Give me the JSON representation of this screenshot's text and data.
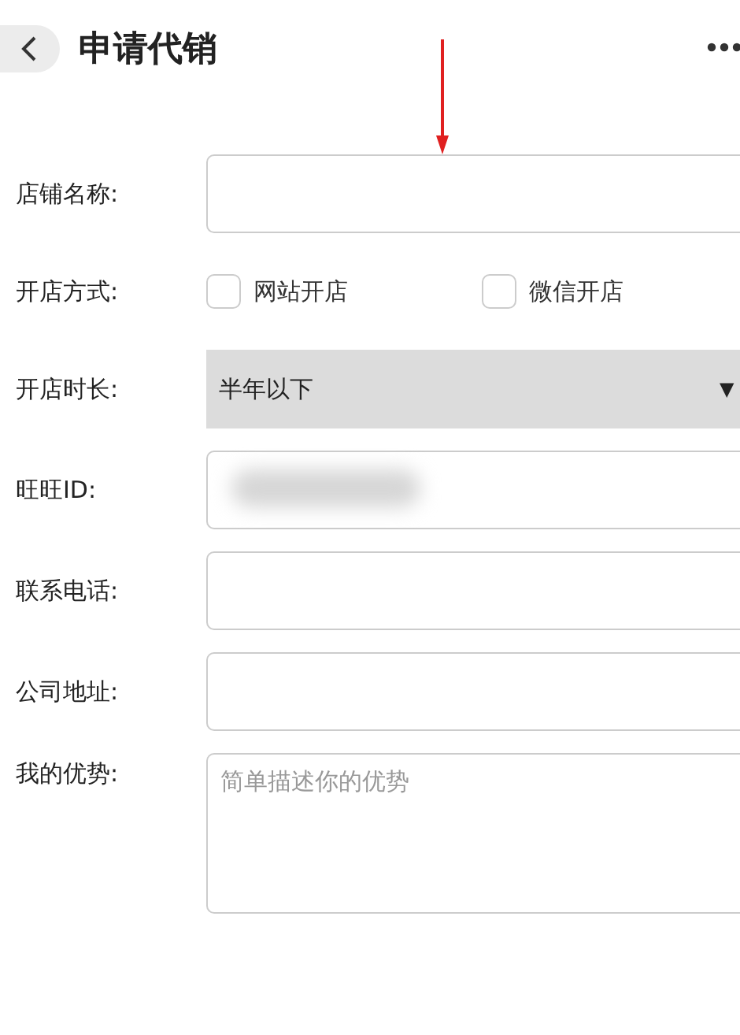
{
  "header": {
    "title": "申请代销"
  },
  "form": {
    "rows": [
      {
        "kind": "text",
        "label": "店铺名称:",
        "value_hidden": false
      },
      {
        "kind": "checks",
        "label": "开店方式:",
        "options": [
          {
            "label": "网站开店",
            "checked": false
          },
          {
            "label": "微信开店",
            "checked": false
          }
        ]
      },
      {
        "kind": "select",
        "label": "开店时长:",
        "value": "半年以下",
        "arrow": "▼"
      },
      {
        "kind": "text",
        "label": "旺旺ID:",
        "value_hidden": true
      },
      {
        "kind": "text",
        "label": "联系电话:",
        "value_hidden": false
      },
      {
        "kind": "text",
        "label": "公司地址:",
        "value_hidden": false
      },
      {
        "kind": "textarea",
        "label": "我的优势:",
        "placeholder": "简单描述你的优势"
      }
    ]
  }
}
